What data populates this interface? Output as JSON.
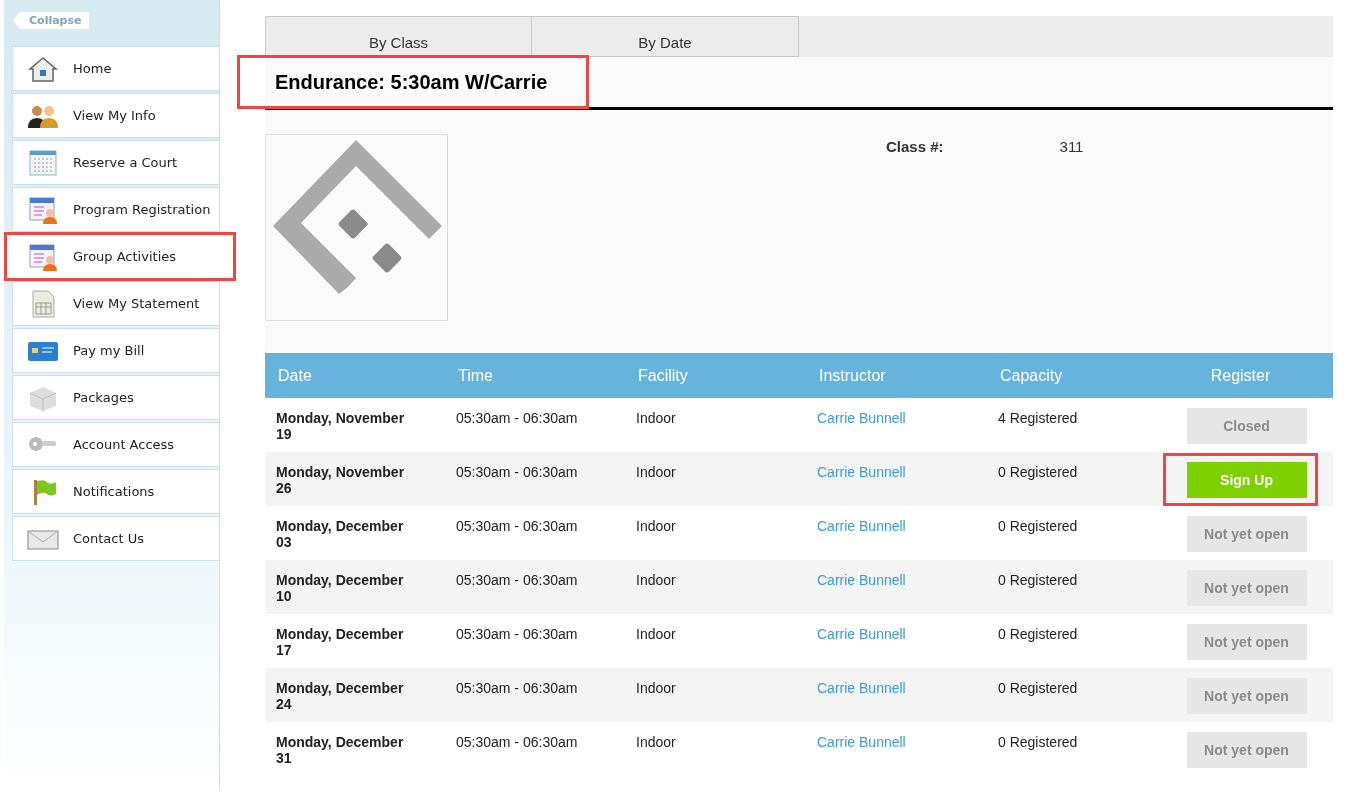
{
  "sidebar": {
    "collapse_label": "Collapse",
    "items": [
      {
        "label": "Home",
        "highlighted": false
      },
      {
        "label": "View My Info",
        "highlighted": false
      },
      {
        "label": "Reserve a Court",
        "highlighted": false
      },
      {
        "label": "Program Registration",
        "highlighted": false
      },
      {
        "label": "Group Activities",
        "highlighted": true
      },
      {
        "label": "View My Statement",
        "highlighted": false
      },
      {
        "label": "Pay my Bill",
        "highlighted": false
      },
      {
        "label": "Packages",
        "highlighted": false
      },
      {
        "label": "Account Access",
        "highlighted": false
      },
      {
        "label": "Notifications",
        "highlighted": false
      },
      {
        "label": "Contact Us",
        "highlighted": false
      }
    ]
  },
  "tabs": [
    {
      "label": "By Class",
      "selected": false
    },
    {
      "label": "By Date",
      "selected": false
    }
  ],
  "class_title": {
    "text": "Endurance: 5:30am W/Carrie",
    "highlighted": true
  },
  "class_info": {
    "label": "Class #:",
    "value": "311"
  },
  "table": {
    "columns": [
      "Date",
      "Time",
      "Facility",
      "Instructor",
      "Capacity",
      "Register"
    ],
    "rows": [
      {
        "date": "Monday, November 19",
        "time": "05:30am - 06:30am",
        "facility": "Indoor",
        "instructor": "Carrie Bunnell",
        "capacity": "4 Registered",
        "register": {
          "label": "Closed",
          "kind": "closed"
        },
        "highlighted": false
      },
      {
        "date": "Monday, November 26",
        "time": "05:30am - 06:30am",
        "facility": "Indoor",
        "instructor": "Carrie Bunnell",
        "capacity": "0 Registered",
        "register": {
          "label": "Sign Up",
          "kind": "open"
        },
        "highlighted": true
      },
      {
        "date": "Monday, December 03",
        "time": "05:30am - 06:30am",
        "facility": "Indoor",
        "instructor": "Carrie Bunnell",
        "capacity": "0 Registered",
        "register": {
          "label": "Not yet open",
          "kind": "pending"
        },
        "highlighted": false
      },
      {
        "date": "Monday, December 10",
        "time": "05:30am - 06:30am",
        "facility": "Indoor",
        "instructor": "Carrie Bunnell",
        "capacity": "0 Registered",
        "register": {
          "label": "Not yet open",
          "kind": "pending"
        },
        "highlighted": false
      },
      {
        "date": "Monday, December 17",
        "time": "05:30am - 06:30am",
        "facility": "Indoor",
        "instructor": "Carrie Bunnell",
        "capacity": "0 Registered",
        "register": {
          "label": "Not yet open",
          "kind": "pending"
        },
        "highlighted": false
      },
      {
        "date": "Monday, December 24",
        "time": "05:30am - 06:30am",
        "facility": "Indoor",
        "instructor": "Carrie Bunnell",
        "capacity": "0 Registered",
        "register": {
          "label": "Not yet open",
          "kind": "pending"
        },
        "highlighted": false
      },
      {
        "date": "Monday, December 31",
        "time": "05:30am - 06:30am",
        "facility": "Indoor",
        "instructor": "Carrie Bunnell",
        "capacity": "0 Registered",
        "register": {
          "label": "Not yet open",
          "kind": "pending"
        },
        "highlighted": false
      }
    ]
  }
}
